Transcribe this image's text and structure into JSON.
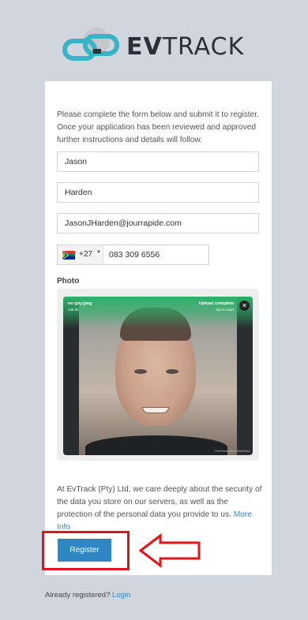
{
  "brand": {
    "name_bold": "EV",
    "name_light": "TRACK",
    "colors": {
      "teal": "#39b4c6",
      "dark": "#2c3136",
      "grey": "#9ea3a8"
    }
  },
  "form": {
    "intro": "Please complete the form below and submit it to register. Once your application has been reviewed and approved further instructions and details will follow.",
    "first_name": "Jason",
    "last_name": "Harden",
    "email": "JasonJHarden@jourrapide.com",
    "phone": {
      "country_code": "+27",
      "number": "083 309 6556",
      "flag_icon": "south-africa-flag-icon"
    },
    "photo_label": "Photo",
    "upload": {
      "file_name": "no guy.jpeg",
      "file_size": "138 kb",
      "status": "Upload complete",
      "hint": "tap to undo",
      "credit": "ThisPersonDoesNotExist"
    },
    "privacy_text": "At EvTrack (Pty) Ltd, we care deeply about the security of the data you store on our servers, as well as the protection of the personal data you provide to us.",
    "privacy_link": "More Info",
    "register_label": "Register"
  },
  "footer": {
    "already_text": "Already registered?",
    "login_link": "Login"
  },
  "annotation": {
    "highlight_color": "#e0141b",
    "arrow_icon": "left-arrow-icon"
  }
}
